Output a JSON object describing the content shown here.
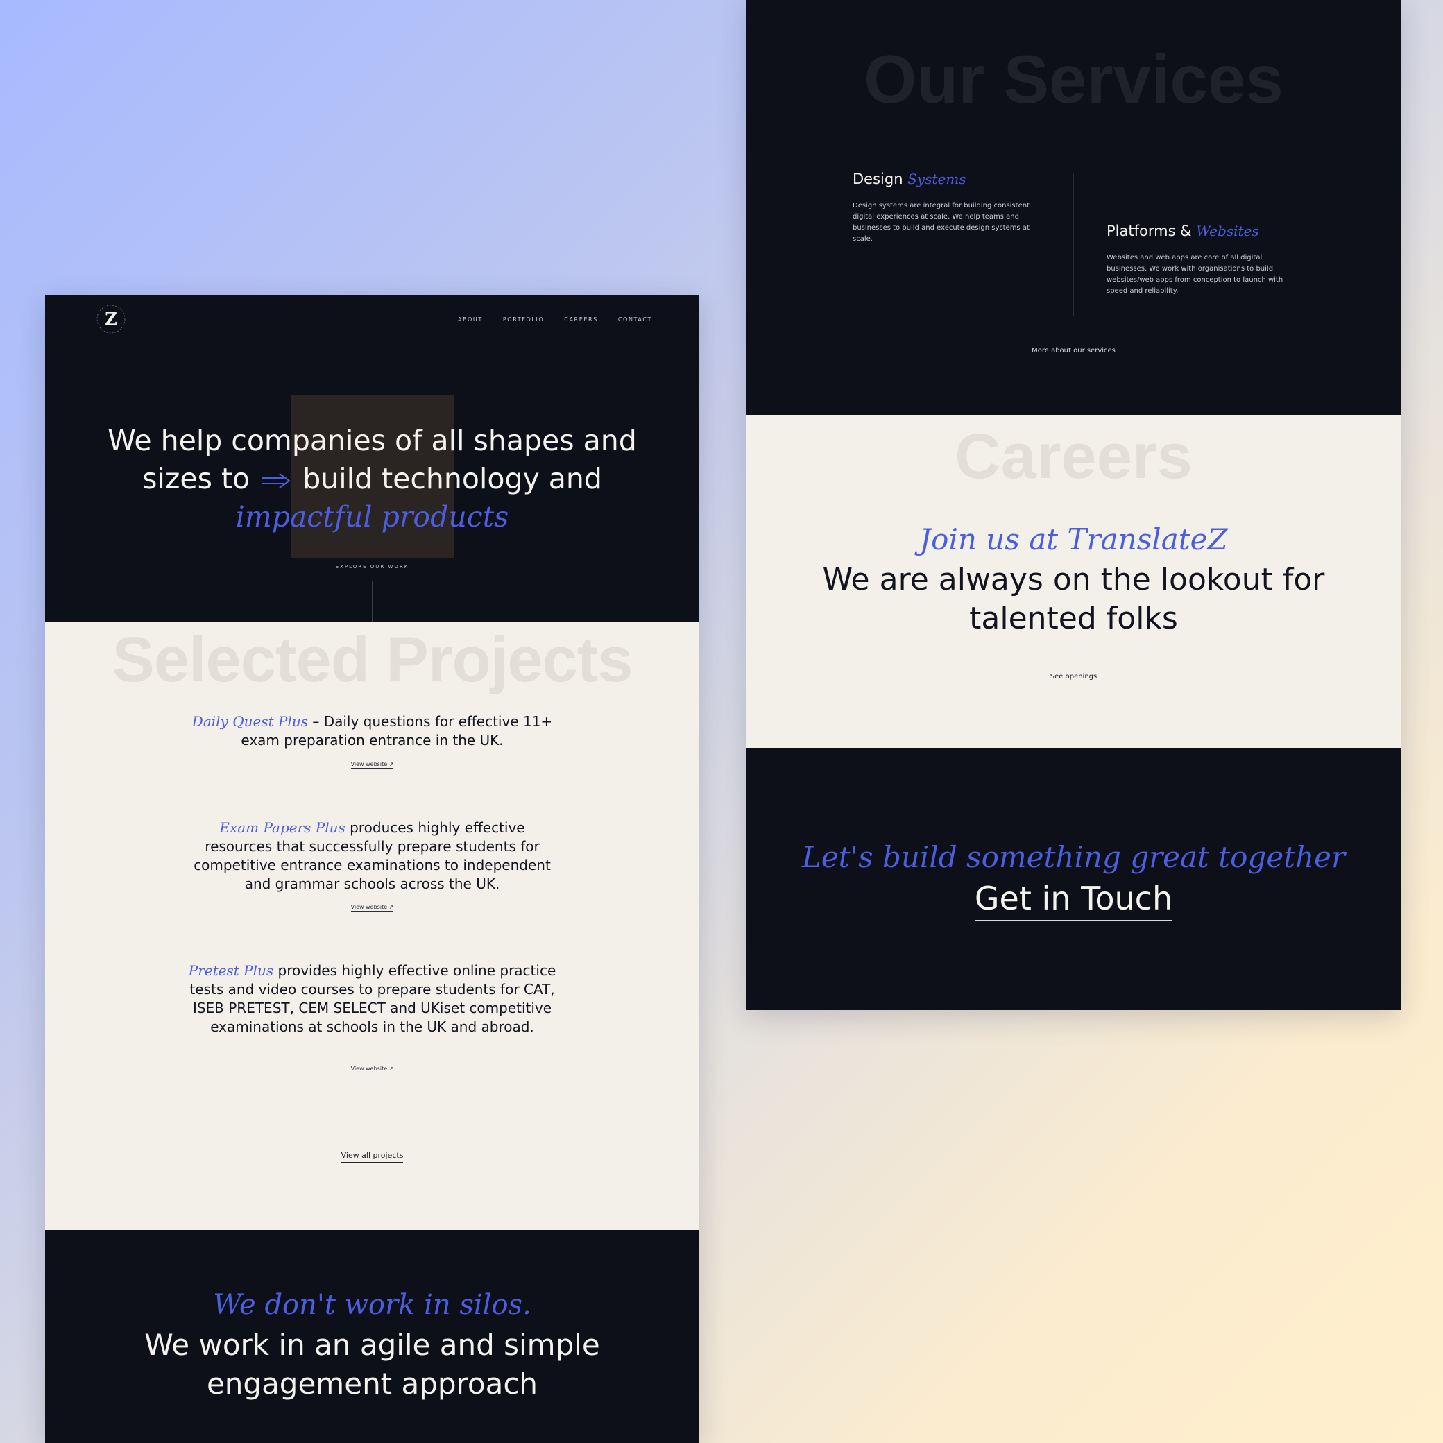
{
  "brand": {
    "logo_letter": "Z",
    "logo_ring_text": "TRANSLATEZ · TRANSLATEZ ·"
  },
  "nav": {
    "items": [
      "ABOUT",
      "PORTFOLIO",
      "CAREERS",
      "CONTACT"
    ]
  },
  "hero": {
    "title_part1": "We help companies of all shapes and",
    "title_part2a": "sizes to",
    "title_part2b": "build technology and",
    "title_accent": "impactful products",
    "explore_label": "EXPLORE OUR WORK"
  },
  "projects": {
    "heading": "Selected Projects",
    "items": [
      {
        "name": "Daily Quest Plus",
        "description": " – Daily questions for effective 11+ exam preparation entrance in the UK.",
        "link_label": "View website ↗"
      },
      {
        "name": "Exam Papers Plus",
        "description": " produces highly effective resources that successfully prepare students for competitive entrance examinations to independent and grammar schools across the UK.",
        "link_label": "View website ↗"
      },
      {
        "name": "Pretest Plus",
        "description": " provides highly effective online practice tests and video courses to prepare students for CAT, ISEB PRETEST, CEM SELECT and UKiset competitive examinations at schools in the UK and abroad.",
        "link_label": "View website ↗"
      }
    ],
    "view_all_label": "View all projects"
  },
  "silos": {
    "accent": "We don't work in silos.",
    "line1": "We work in an agile and simple",
    "line2": "engagement approach"
  },
  "services": {
    "heading": "Our Services",
    "items": [
      {
        "title": "Design",
        "title_accent": "Systems",
        "description": "Design systems are integral for building consistent digital experiences at scale. We help teams and businesses to build and execute design systems at scale."
      },
      {
        "title": "Platforms &",
        "title_accent": "Websites",
        "description": "Websites and web apps are core of all digital businesses. We work with organisations to build websites/web apps from conception to launch with speed and reliability."
      }
    ],
    "link_label": "More about our services"
  },
  "careers": {
    "heading": "Careers",
    "accent": "Join us at TranslateZ",
    "line1": "We are always on the lookout for",
    "line2": "talented folks",
    "link_label": "See openings"
  },
  "contact": {
    "accent": "Let's build something great together",
    "cta_label": "Get in Touch"
  },
  "colors": {
    "accent": "#4b5ee0",
    "dark_bg": "#0e1019",
    "light_bg": "#f3f0ea"
  }
}
